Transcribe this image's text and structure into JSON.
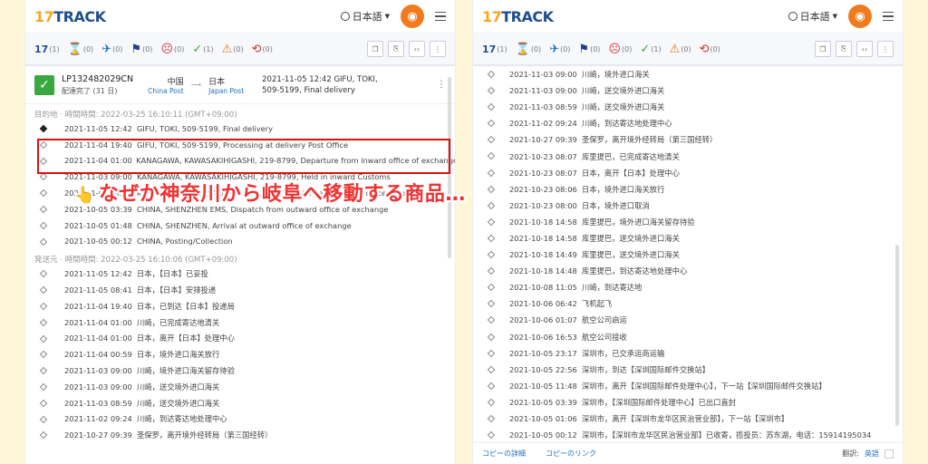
{
  "brand": {
    "logo_num": "17",
    "logo_text": "TRACK"
  },
  "header": {
    "language": "日本語"
  },
  "tabs": [
    {
      "icon": "17",
      "count": "(1)"
    },
    {
      "icon": "⌛",
      "count": "(0)"
    },
    {
      "icon": "✈",
      "count": "(0)"
    },
    {
      "icon": "⚑",
      "count": "(0)"
    },
    {
      "icon": "☹",
      "count": "(0)"
    },
    {
      "icon": "✓",
      "count": "(1)"
    },
    {
      "icon": "⚠",
      "count": "(0)"
    },
    {
      "icon": "⟲",
      "count": "(0)"
    }
  ],
  "package": {
    "id": "LP132482029CN",
    "status": "配達完了 (31 日)",
    "origin": "中国",
    "origin_post": "China Post",
    "dest": "日本",
    "dest_post": "Japan Post",
    "last_event_line1": "2021-11-05 12:42  GIFU, TOKI,",
    "last_event_line2": "509-5199, Final delivery"
  },
  "dest_section": "目的地 · 時間時間: 2022-03-25 16:10:11 (GMT+09:00)",
  "dest_events": [
    {
      "t": "2021-11-05 12:42",
      "d": "GIFU, TOKI, 509-5199, Final delivery"
    },
    {
      "t": "2021-11-04 19:40",
      "d": "GIFU, TOKI, 509-5199, Processing at delivery Post Office"
    },
    {
      "t": "2021-11-04 01:00",
      "d": "KANAGAWA, KAWASAKIHIGASHI, 219-8799, Departure from inward office of exchange"
    },
    {
      "t": "2021-11-03 09:00",
      "d": "KANAGAWA, KAWASAKIHIGASHI, 219-8799, Held in inward Customs"
    },
    {
      "t": "2021-11-03 09:00",
      "d": "KANAGAWA, KAWASAKIHIGASHI, 219-8799, Arrival at inward office of exchange"
    },
    {
      "t": "2021-10-05 03:39",
      "d": "CHINA, SHENZHEN EMS, Dispatch from outward office of exchange"
    },
    {
      "t": "2021-10-05 01:48",
      "d": "CHINA, SHENZHEN, Arrival at outward office of exchange"
    },
    {
      "t": "2021-10-05 00:12",
      "d": "CHINA, Posting/Collection"
    }
  ],
  "origin_section": "発送元 · 時間時間: 2022-03-25 16:10:06 (GMT+09:00)",
  "origin_events": [
    {
      "t": "2021-11-05 12:42",
      "d": "日本，【日本】已妥投"
    },
    {
      "t": "2021-11-05 08:41",
      "d": "日本，【日本】安排投递"
    },
    {
      "t": "2021-11-04 19:40",
      "d": "日本，已到达【日本】投递局"
    },
    {
      "t": "2021-11-04 01:00",
      "d": "川崎，已完成寄达地清关"
    },
    {
      "t": "2021-11-04 01:00",
      "d": "日本，离开【日本】处理中心"
    },
    {
      "t": "2021-11-04 00:59",
      "d": "日本，境外进口海关放行"
    },
    {
      "t": "2021-11-03 09:00",
      "d": "川崎，境外进口海关留存待验"
    },
    {
      "t": "2021-11-03 09:00",
      "d": "川崎，送交境外进口海关"
    },
    {
      "t": "2021-11-03 08:59",
      "d": "川崎，送交境外进口海关"
    },
    {
      "t": "2021-11-02 09:24",
      "d": "川崎，到达寄达地处理中心"
    },
    {
      "t": "2021-10-27 09:39",
      "d": "圣保罗，离开境外经转局（第三国经转）"
    }
  ],
  "right_events": [
    {
      "t": "2021-11-03 09:00",
      "d": "川崎，境外进口海关"
    },
    {
      "t": "2021-11-03 09:00",
      "d": "川崎，送交境外进口海关"
    },
    {
      "t": "2021-11-03 08:59",
      "d": "川崎，送交境外进口海关"
    },
    {
      "t": "2021-11-02 09:24",
      "d": "川崎，到达寄达地处理中心"
    },
    {
      "t": "2021-10-27 09:39",
      "d": "圣保罗，离开境外经转局（第三国经转）"
    },
    {
      "t": "2021-10-23 08:07",
      "d": "库里提巴，已完成寄达地清关"
    },
    {
      "t": "2021-10-23 08:07",
      "d": "日本，离开【日本】处理中心"
    },
    {
      "t": "2021-10-23 08:06",
      "d": "日本，境外进口海关放行"
    },
    {
      "t": "2021-10-23 08:00",
      "d": "日本，境外进口取消"
    },
    {
      "t": "2021-10-18 14:58",
      "d": "库里提巴，境外进口海关留存待验"
    },
    {
      "t": "2021-10-18 14:58",
      "d": "库里提巴，送交境外进口海关"
    },
    {
      "t": "2021-10-18 14:49",
      "d": "库里提巴，送交境外进口海关"
    },
    {
      "t": "2021-10-18 14:48",
      "d": "库里提巴，到达寄达地处理中心"
    },
    {
      "t": "2021-10-08 11:05",
      "d": "川崎，到达寄达地"
    },
    {
      "t": "2021-10-06 06:42",
      "d": "飞机起飞"
    },
    {
      "t": "2021-10-06 01:07",
      "d": "航空公司启运"
    },
    {
      "t": "2021-10-06 16:53",
      "d": "航空公司接收"
    },
    {
      "t": "2021-10-05 23:17",
      "d": "深圳市，已交承运商运输"
    },
    {
      "t": "2021-10-05 22:56",
      "d": "深圳市，到达【深圳国际邮件交换站】"
    },
    {
      "t": "2021-10-05 11:48",
      "d": "深圳市，离开【深圳国际邮件处理中心】，下一站【深圳国际邮件交换站】"
    },
    {
      "t": "2021-10-05 03:39",
      "d": "深圳市，【深圳国际邮件处理中心】已出口直封"
    },
    {
      "t": "2021-10-05 01:06",
      "d": "深圳市，离开【深圳市龙华区民治营业部】，下一站【深圳市】"
    },
    {
      "t": "2021-10-05 00:12",
      "d": "深圳市，【深圳市龙华区民治营业部】已收寄，揽投员：苏东湖，电话：15914195034"
    }
  ],
  "footer": {
    "copy_detail": "コピーの詳細",
    "copy_link": "コピーのリンク",
    "translate_label": "翻訳:",
    "translate_value": "英語"
  },
  "caption": "なぜか神奈川から岐阜へ移動する商品…",
  "colors": {
    "brand": "#1f4f8f",
    "accent": "#f07b1d",
    "highlight": "#dd1111",
    "caption": "#ee3333",
    "delivered": "#3aa841"
  }
}
